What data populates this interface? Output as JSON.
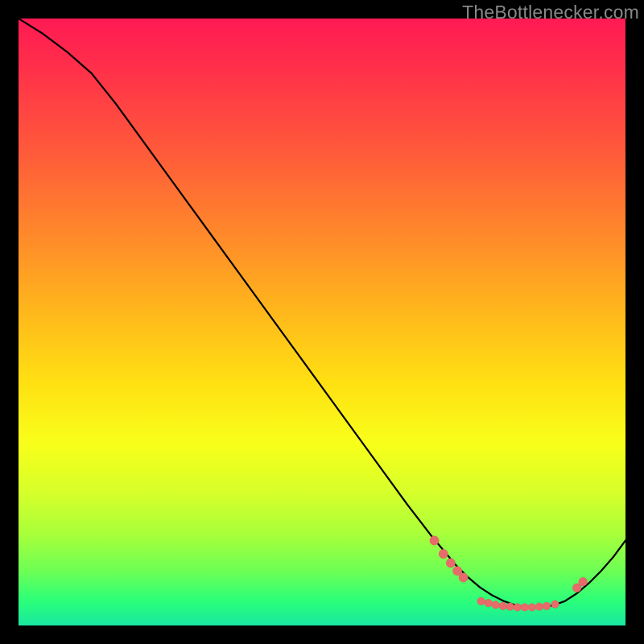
{
  "watermark": "TheBottlenecker.com",
  "colors": {
    "curve_stroke": "#000000",
    "marker_fill": "#e96a6a",
    "marker_stroke": "#d85a5a"
  },
  "chart_data": {
    "type": "line",
    "title": "",
    "xlabel": "",
    "ylabel": "",
    "xlim": [
      0,
      100
    ],
    "ylim": [
      0,
      100
    ],
    "series": [
      {
        "name": "curve",
        "x": [
          0,
          4,
          8,
          12,
          16,
          20,
          24,
          28,
          32,
          36,
          40,
          44,
          48,
          52,
          56,
          60,
          64,
          68,
          72,
          74,
          76,
          78,
          80,
          82,
          84,
          86,
          88,
          90,
          92,
          94,
          96,
          98,
          100
        ],
        "y": [
          100,
          97.5,
          94.5,
          91,
          86,
          80.5,
          75,
          69.5,
          64,
          58.5,
          53,
          47.5,
          42,
          36.5,
          31,
          25.5,
          20,
          14.8,
          10,
          8,
          6.3,
          5,
          4,
          3.3,
          3,
          3,
          3.3,
          4,
          5.3,
          7,
          9,
          11.3,
          14
        ]
      }
    ],
    "markers": [
      {
        "x": 68.5,
        "y": 14.0,
        "r": 1.0
      },
      {
        "x": 70.0,
        "y": 11.8,
        "r": 1.0
      },
      {
        "x": 71.2,
        "y": 10.3,
        "r": 1.0
      },
      {
        "x": 72.3,
        "y": 9.0,
        "r": 1.0
      },
      {
        "x": 73.3,
        "y": 7.9,
        "r": 1.0
      },
      {
        "x": 76.2,
        "y": 4.0,
        "r": 0.85
      },
      {
        "x": 77.4,
        "y": 3.7,
        "r": 0.85
      },
      {
        "x": 78.6,
        "y": 3.4,
        "r": 0.85
      },
      {
        "x": 79.8,
        "y": 3.2,
        "r": 0.85
      },
      {
        "x": 81.0,
        "y": 3.1,
        "r": 0.85
      },
      {
        "x": 82.2,
        "y": 3.0,
        "r": 0.85
      },
      {
        "x": 83.4,
        "y": 3.0,
        "r": 0.85
      },
      {
        "x": 84.6,
        "y": 3.0,
        "r": 0.85
      },
      {
        "x": 85.8,
        "y": 3.1,
        "r": 0.85
      },
      {
        "x": 87.0,
        "y": 3.2,
        "r": 0.85
      },
      {
        "x": 88.4,
        "y": 3.5,
        "r": 0.85
      },
      {
        "x": 92.0,
        "y": 6.2,
        "r": 0.95
      },
      {
        "x": 93.0,
        "y": 7.2,
        "r": 0.95
      }
    ]
  }
}
